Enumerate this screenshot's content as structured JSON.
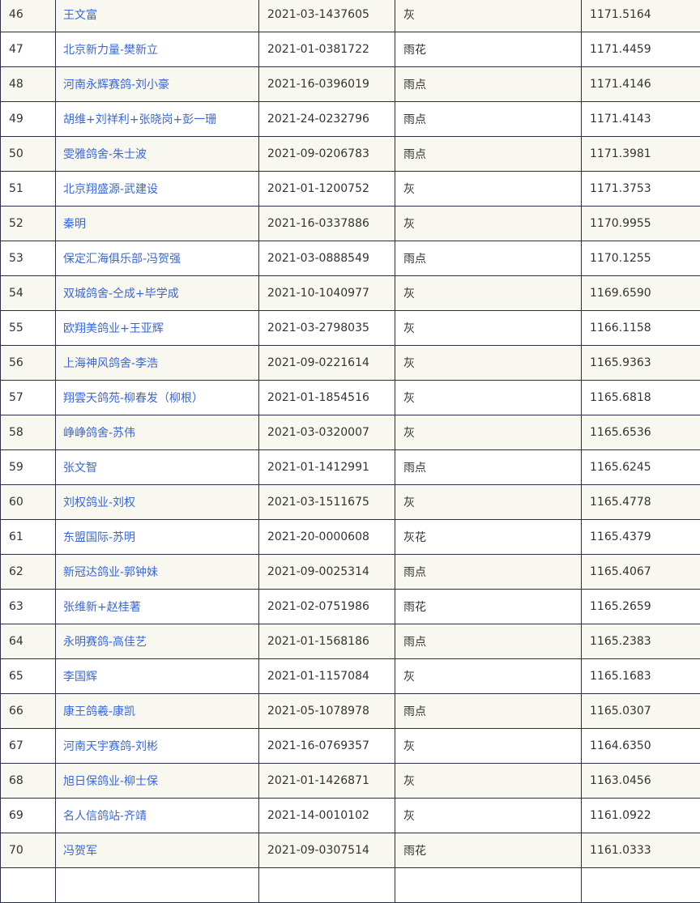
{
  "rows": [
    {
      "rank": "46",
      "name": "王文富",
      "ring": "2021-03-1437605",
      "color": "灰",
      "speed": "1171.5164"
    },
    {
      "rank": "47",
      "name": "北京新力量-樊新立",
      "ring": "2021-01-0381722",
      "color": "雨花",
      "speed": "1171.4459"
    },
    {
      "rank": "48",
      "name": "河南永辉赛鸽-刘小豪",
      "ring": "2021-16-0396019",
      "color": "雨点",
      "speed": "1171.4146"
    },
    {
      "rank": "49",
      "name": "胡维+刘祥利+张晓岗+彭一珊",
      "ring": "2021-24-0232796",
      "color": "雨点",
      "speed": "1171.4143"
    },
    {
      "rank": "50",
      "name": "雯雅鸽舍-朱士波",
      "ring": "2021-09-0206783",
      "color": "雨点",
      "speed": "1171.3981"
    },
    {
      "rank": "51",
      "name": "北京翔盛源-武建设",
      "ring": "2021-01-1200752",
      "color": "灰",
      "speed": "1171.3753"
    },
    {
      "rank": "52",
      "name": "秦明",
      "ring": "2021-16-0337886",
      "color": "灰",
      "speed": "1170.9955"
    },
    {
      "rank": "53",
      "name": "保定汇海俱乐部-冯贺强",
      "ring": "2021-03-0888549",
      "color": "雨点",
      "speed": "1170.1255"
    },
    {
      "rank": "54",
      "name": "双城鸽舍-仝成+毕学成",
      "ring": "2021-10-1040977",
      "color": "灰",
      "speed": "1169.6590"
    },
    {
      "rank": "55",
      "name": "欧翔美鸽业+王亚辉",
      "ring": "2021-03-2798035",
      "color": "灰",
      "speed": "1166.1158"
    },
    {
      "rank": "56",
      "name": "上海神风鸽舍-李浩",
      "ring": "2021-09-0221614",
      "color": "灰",
      "speed": "1165.9363"
    },
    {
      "rank": "57",
      "name": "翔雲天鸽苑-柳春发（柳根）",
      "ring": "2021-01-1854516",
      "color": "灰",
      "speed": "1165.6818"
    },
    {
      "rank": "58",
      "name": "峥峥鸽舍-苏伟",
      "ring": "2021-03-0320007",
      "color": "灰",
      "speed": "1165.6536"
    },
    {
      "rank": "59",
      "name": "张文智",
      "ring": "2021-01-1412991",
      "color": "雨点",
      "speed": "1165.6245"
    },
    {
      "rank": "60",
      "name": "刘权鸽业-刘权",
      "ring": "2021-03-1511675",
      "color": "灰",
      "speed": "1165.4778"
    },
    {
      "rank": "61",
      "name": "东盟国际-苏明",
      "ring": "2021-20-0000608",
      "color": "灰花",
      "speed": "1165.4379"
    },
    {
      "rank": "62",
      "name": "新冠达鸽业-郭钟妹",
      "ring": "2021-09-0025314",
      "color": "雨点",
      "speed": "1165.4067"
    },
    {
      "rank": "63",
      "name": "张维新+赵桂著",
      "ring": "2021-02-0751986",
      "color": "雨花",
      "speed": "1165.2659"
    },
    {
      "rank": "64",
      "name": "永明赛鸽-高佳艺",
      "ring": "2021-01-1568186",
      "color": "雨点",
      "speed": "1165.2383"
    },
    {
      "rank": "65",
      "name": "李国辉",
      "ring": "2021-01-1157084",
      "color": "灰",
      "speed": "1165.1683"
    },
    {
      "rank": "66",
      "name": "康王鸽羲-康凯",
      "ring": "2021-05-1078978",
      "color": "雨点",
      "speed": "1165.0307"
    },
    {
      "rank": "67",
      "name": "河南天宇赛鸽-刘彬",
      "ring": "2021-16-0769357",
      "color": "灰",
      "speed": "1164.6350"
    },
    {
      "rank": "68",
      "name": "旭日保鸽业-柳士保",
      "ring": "2021-01-1426871",
      "color": "灰",
      "speed": "1163.0456"
    },
    {
      "rank": "69",
      "name": "名人信鸽站-齐靖",
      "ring": "2021-14-0010102",
      "color": "灰",
      "speed": "1161.0922"
    },
    {
      "rank": "70",
      "name": "冯贺军",
      "ring": "2021-09-0307514",
      "color": "雨花",
      "speed": "1161.0333"
    },
    {
      "rank": "",
      "name": "",
      "ring": "",
      "color": "",
      "speed": ""
    }
  ]
}
